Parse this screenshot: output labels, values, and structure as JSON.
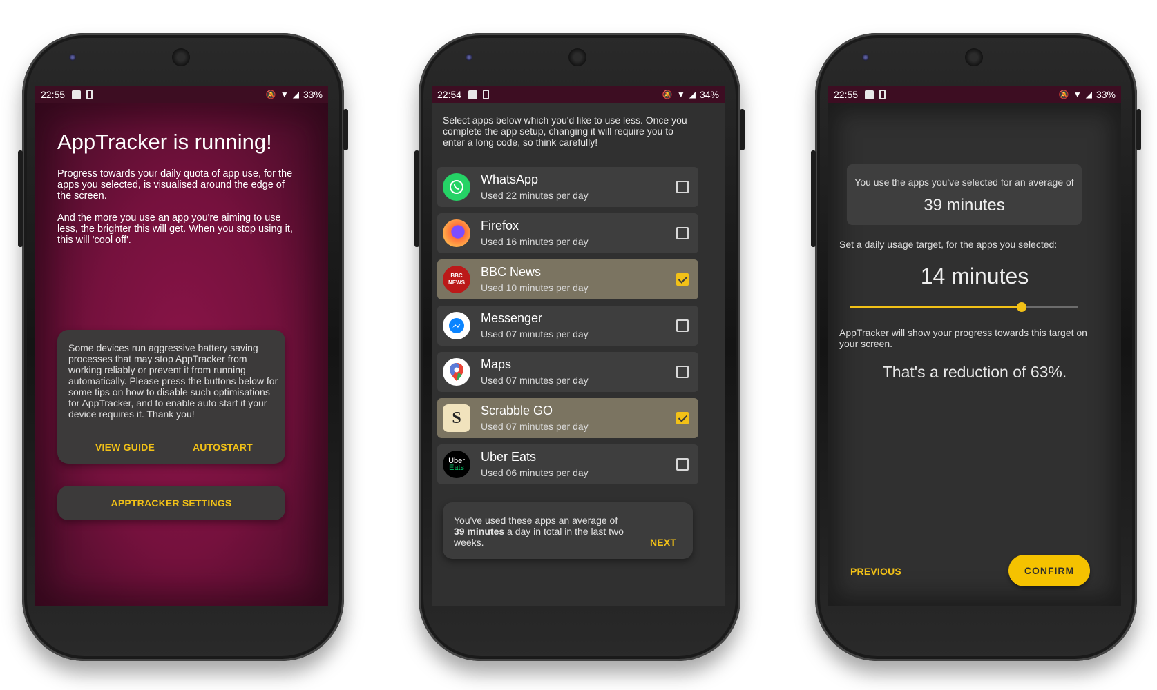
{
  "screen1": {
    "status": {
      "time": "22:55",
      "battery": "33%"
    },
    "title": "AppTracker is running!",
    "para1": "Progress towards your daily quota of app use, for the apps you selected, is visualised around the edge of the screen.",
    "para2": "And the more you use an app you're aiming to use less, the brighter this will get. When you stop using it, this will 'cool off'.",
    "card_text": "Some devices run aggressive battery saving processes that may stop AppTracker from working reliably or prevent it from running automatically. Please press the buttons below for some tips on how to disable such optimisations for AppTracker, and to enable auto start if your device requires it. Thank you!",
    "view_guide": "VIEW GUIDE",
    "autostart": "AUTOSTART",
    "settings": "APPTRACKER SETTINGS"
  },
  "screen2": {
    "status": {
      "time": "22:54",
      "battery": "34%"
    },
    "intro": "Select apps below which you'd like to use less. Once you complete the app setup, changing it will require you to enter a long code, so think carefully!",
    "apps": [
      {
        "name": "WhatsApp",
        "usage": "Used 22 minutes per day",
        "checked": false,
        "icon": "whatsapp-icon",
        "color": "#25d366"
      },
      {
        "name": "Firefox",
        "usage": "Used 16 minutes per day",
        "checked": false,
        "icon": "firefox-icon",
        "color": "#ff7139"
      },
      {
        "name": "BBC News",
        "usage": "Used 10 minutes per day",
        "checked": true,
        "icon": "bbc-news-icon",
        "color": "#bb1919"
      },
      {
        "name": "Messenger",
        "usage": "Used 07 minutes per day",
        "checked": false,
        "icon": "messenger-icon",
        "color": "#0084ff"
      },
      {
        "name": "Maps",
        "usage": "Used 07 minutes per day",
        "checked": false,
        "icon": "maps-icon",
        "color": "#34a853"
      },
      {
        "name": "Scrabble GO",
        "usage": "Used 07 minutes per day",
        "checked": true,
        "icon": "scrabble-icon",
        "color": "#e8d7a8"
      },
      {
        "name": "Uber Eats",
        "usage": "Used 06 minutes per day",
        "checked": false,
        "icon": "uber-eats-icon",
        "color": "#000000"
      }
    ],
    "bbc_badge": "BBC NEWS",
    "uber_badge_1": "Uber",
    "uber_badge_2": "Eats",
    "scrabble_badge": "S",
    "footer_pre": "You've used these apps an average of ",
    "footer_bold": "39 minutes",
    "footer_post": " a day in total in the last two weeks.",
    "next": "NEXT"
  },
  "screen3": {
    "status": {
      "time": "22:55",
      "battery": "33%"
    },
    "avg_label": "You use the apps you've selected for an average of",
    "avg_value": "39 minutes",
    "target_label": "Set a daily usage target, for the apps you selected:",
    "target_value": "14 minutes",
    "slider_fraction": 0.75,
    "progress_note": "AppTracker will show your progress towards this target on your screen.",
    "reduction": "That's a reduction of 63%.",
    "previous": "PREVIOUS",
    "confirm": "CONFIRM"
  },
  "colors": {
    "accent": "#f2c117",
    "status_bar": "#3d0d22",
    "running_bg": "#8a1448",
    "card": "#3c3a3a"
  }
}
